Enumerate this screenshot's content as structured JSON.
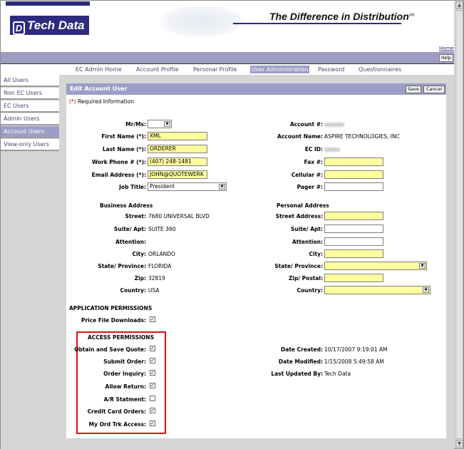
{
  "header": {
    "logo_text": "Tech Data",
    "logo_mark": "D",
    "tagline": "The Difference in Distribution",
    "tagline_mark": "SM",
    "home_link": "Home",
    "help_button": "Help"
  },
  "topnav": [
    "EC Admin Home",
    "Account Profile",
    "Personal Profile",
    "User Administration",
    "Password",
    "Questionnaires"
  ],
  "sidebar": [
    "All Users",
    "Non EC Users",
    "EC Users",
    "Admin Users",
    "Account Users",
    "View-only Users"
  ],
  "panel": {
    "title": "Edit Account User",
    "save_label": "Save",
    "cancel_label": "Cancel",
    "required_mark": "(*)",
    "required_text": "Required Information"
  },
  "user": {
    "mr_ms_label": "Mr/Ms:",
    "mr_ms_value": "",
    "first_name_label": "First Name (*):",
    "first_name": "XML",
    "last_name_label": "Last Name (*):",
    "last_name": "ORDERER",
    "work_phone_label": "Work Phone # (*):",
    "work_phone": "(407) 248-1481",
    "email_label": "Email Address (*):",
    "email": "JOHN@QUOTEWERK",
    "job_title_label": "Job Title:",
    "job_title": "President"
  },
  "account": {
    "account_no_label": "Account #:",
    "account_name_label": "Account Name:",
    "account_name": "ASPIRE TECHNOLOGIES, INC",
    "ec_id_label": "EC ID:",
    "fax_label": "Fax #:",
    "cellular_label": "Cellular #:",
    "pager_label": "Pager #:"
  },
  "business_address": {
    "title": "Business Address",
    "street_label": "Street:",
    "street": "7680 UNIVERSAL BLVD",
    "suite_label": "Suite/ Apt:",
    "suite": "SUITE 360",
    "attention_label": "Attention:",
    "city_label": "City:",
    "city": "ORLANDO",
    "state_label": "State/ Province:",
    "state": "FLORIDA",
    "zip_label": "Zip:",
    "zip": "32819",
    "country_label": "Country:",
    "country": "USA"
  },
  "personal_address": {
    "title": "Personal Address",
    "street_label": "Street Address:",
    "suite_label": "Suite/ Apt:",
    "attention_label": "Attention:",
    "city_label": "City:",
    "state_label": "State/ Province:",
    "zip_label": "Zip/ Postal:",
    "country_label": "Country:"
  },
  "app_permissions": {
    "title": "APPLICATION PERMISSIONS",
    "price_file_label": "Price File Downloads:",
    "price_file_checked": true
  },
  "access_permissions": {
    "title": "ACCESS PERMISSIONS",
    "items": [
      {
        "label": "Obtain and Save Quote:",
        "checked": true
      },
      {
        "label": "Submit Order:",
        "checked": true
      },
      {
        "label": "Order Inquiry:",
        "checked": true
      },
      {
        "label": "Allow Return:",
        "checked": true
      },
      {
        "label": "A/R Statment:",
        "checked": false
      },
      {
        "label": "Credit Card Orders:",
        "checked": true
      },
      {
        "label": "My Ord Trk Access:",
        "checked": true
      }
    ]
  },
  "audit": {
    "date_created_label": "Date Created:",
    "date_created": "10/17/2007 9:19:01 AM",
    "date_modified_label": "Date Modified:",
    "date_modified": "1/15/2008 5:49:58 AM",
    "last_updated_label": "Last Updated By:",
    "last_updated_by": "Tech Data"
  },
  "colors": {
    "brand": "#2e2a7e",
    "accent": "#9d9ec7",
    "highlight_field": "#ffff9e",
    "annotation": "#e01010"
  },
  "icons": {
    "checkbox_check": "✓",
    "dropdown": "▼"
  }
}
